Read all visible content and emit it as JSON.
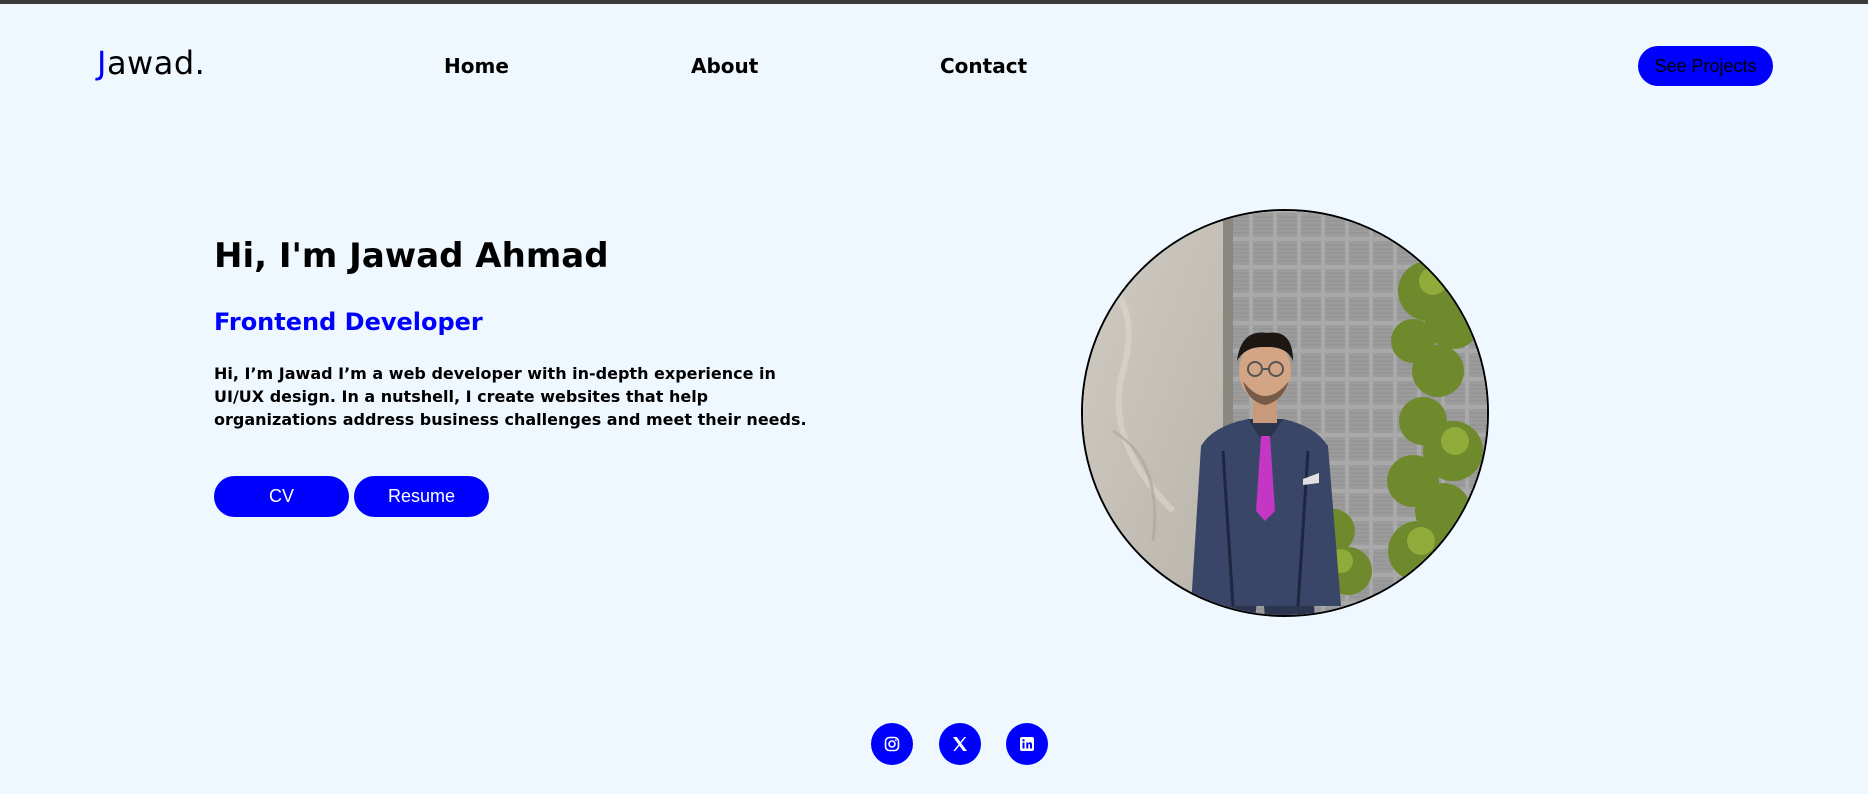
{
  "brand": {
    "logo_first": "J",
    "logo_rest": "awad."
  },
  "nav": {
    "home": "Home",
    "about": "About",
    "contact": "Contact",
    "cta": "See Projects"
  },
  "hero": {
    "title": "Hi, I'm Jawad Ahmad",
    "role": "Frontend Developer",
    "bio": "Hi, I’m Jawad I’m a web developer with in-depth experience in UI/UX design. In a nutshell, I create websites that help organizations address business challenges and meet their needs.",
    "buttons": {
      "cv": "CV",
      "resume": "Resume"
    }
  },
  "social": [
    {
      "icon": "instagram-icon"
    },
    {
      "icon": "x-twitter-icon"
    },
    {
      "icon": "linkedin-icon"
    }
  ],
  "colors": {
    "accent": "#0000ff",
    "background": "#f0f8ff",
    "text": "#000000"
  }
}
